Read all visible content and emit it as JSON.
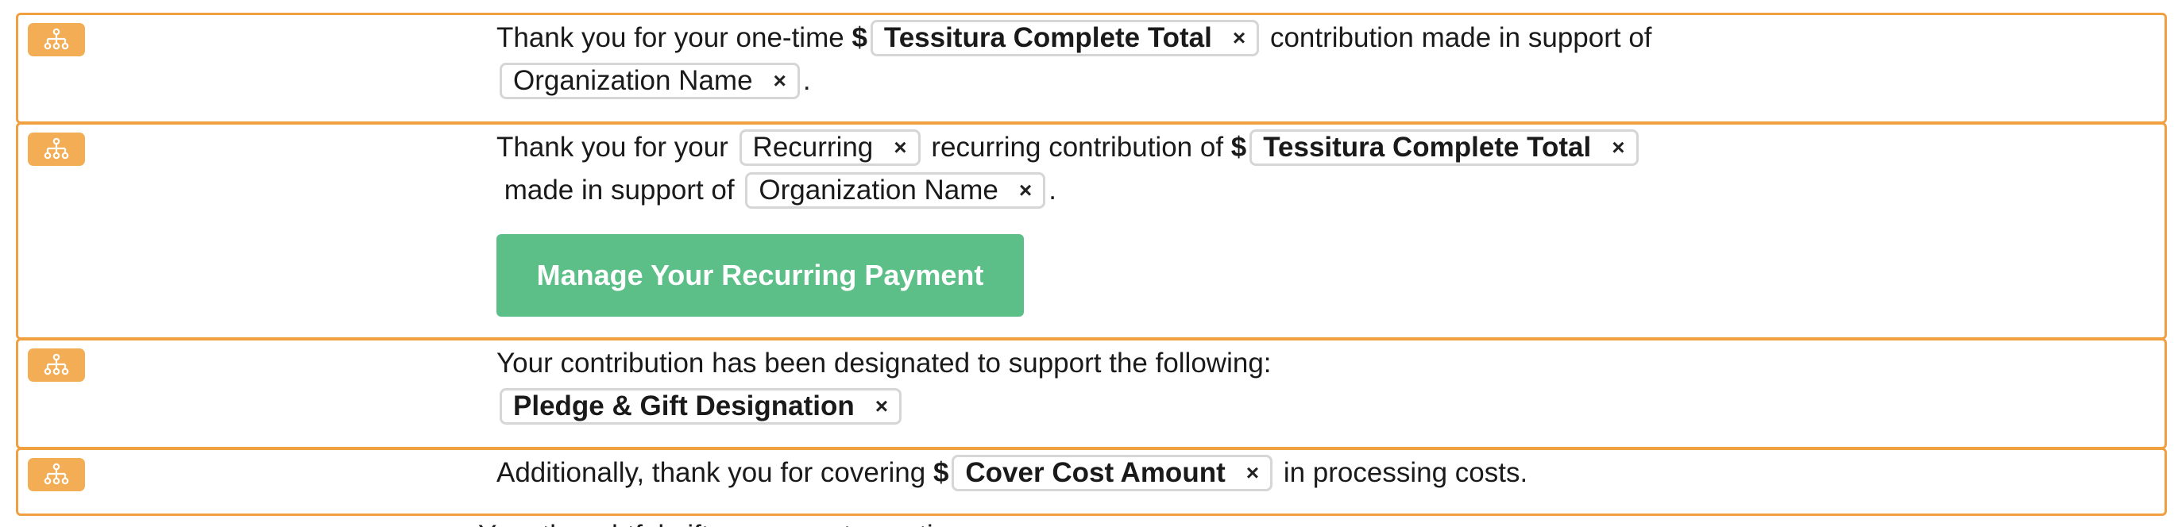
{
  "block1": {
    "text_a": "Thank you for your one-time ",
    "currency": "$",
    "token_total": "Tessitura Complete Total",
    "text_b": " contribution made in support of",
    "token_org": "Organization Name",
    "text_end": "."
  },
  "block2": {
    "text_a": "Thank you for your ",
    "token_recurring": "Recurring",
    "text_b": " recurring contribution of ",
    "currency": "$",
    "token_total": "Tessitura Complete Total",
    "text_c": " made in support of ",
    "token_org": "Organization Name",
    "text_end": ".",
    "button_label": "Manage Your Recurring Payment"
  },
  "block3": {
    "text_a": "Your contribution has been designated to support the following:",
    "token_designation": "Pledge & Gift Designation"
  },
  "block4": {
    "text_a": "Additionally, thank you for covering ",
    "currency": "$",
    "token_cover": "Cover Cost Amount",
    "text_b": " in processing costs."
  },
  "trailing_text": "Your thoughtful gift moves us to continue",
  "token_remove_glyph": "×",
  "colors": {
    "block_border": "#f0a040",
    "badge": "#f2ad55",
    "button": "#5cbf88"
  },
  "icons": {
    "condition_badge": "hierarchy-icon",
    "token_remove": "close-icon"
  }
}
